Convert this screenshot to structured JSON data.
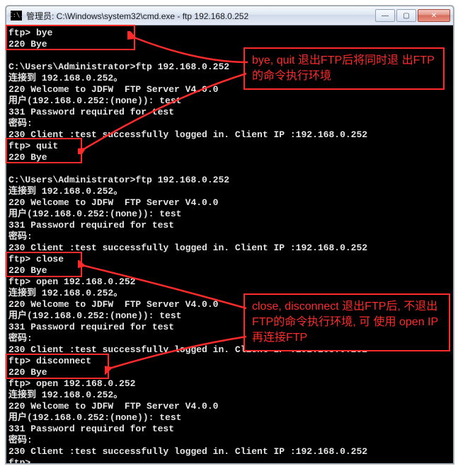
{
  "window": {
    "icon_text": "C:\\.",
    "title": "管理员: C:\\Windows\\system32\\cmd.exe - ftp  192.168.0.252",
    "buttons": {
      "min": "—",
      "max": "▢",
      "close": "✕"
    }
  },
  "console_lines": [
    "ftp> bye",
    "220 Bye",
    "",
    "C:\\Users\\Administrator>ftp 192.168.0.252",
    "连接到 192.168.0.252。",
    "220 Welcome to JDFW  FTP Server V4.0.0",
    "用户(192.168.0.252:(none)): test",
    "331 Password required for test",
    "密码:",
    "230 Client :test successfully logged in. Client IP :192.168.0.252",
    "ftp> quit",
    "220 Bye",
    "",
    "C:\\Users\\Administrator>ftp 192.168.0.252",
    "连接到 192.168.0.252。",
    "220 Welcome to JDFW  FTP Server V4.0.0",
    "用户(192.168.0.252:(none)): test",
    "331 Password required for test",
    "密码:",
    "230 Client :test successfully logged in. Client IP :192.168.0.252",
    "ftp> close",
    "220 Bye",
    "ftp> open 192.168.0.252",
    "连接到 192.168.0.252。",
    "220 Welcome to JDFW  FTP Server V4.0.0",
    "用户(192.168.0.252:(none)): test",
    "331 Password required for test",
    "密码:",
    "230 Client :test successfully logged in. Client IP :192.168.0.252",
    "ftp> disconnect",
    "220 Bye",
    "ftp> open 192.168.0.252",
    "连接到 192.168.0.252。",
    "220 Welcome to JDFW  FTP Server V4.0.0",
    "用户(192.168.0.252:(none)): test",
    "331 Password required for test",
    "密码:",
    "230 Client :test successfully logged in. Client IP :192.168.0.252",
    "ftp>"
  ],
  "callouts": {
    "top": "bye, quit 退出FTP后将同时退\n出FTP的命令执行环境",
    "bottom": "close, disconnect 退出FTP后,\n不退出FTP的命令执行环境, 可\n使用 open IP 再连接FTP"
  }
}
